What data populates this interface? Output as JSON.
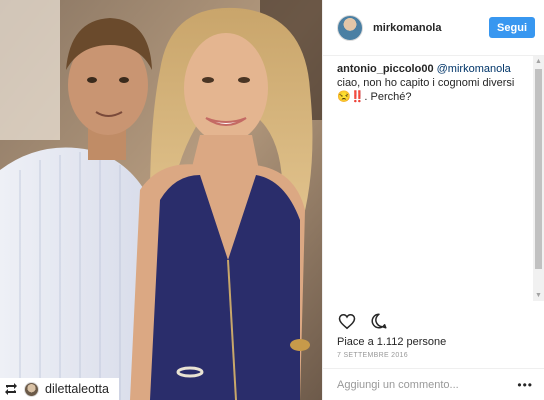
{
  "post": {
    "author": "mirkomanola",
    "follow_label": "Segui"
  },
  "comment": {
    "user": "antonio_piccolo00",
    "mention": "@mirkomanola",
    "text": " ciao, non ho capito i cognomi diversi😒‼️. Perché?"
  },
  "actions": {
    "like_icon": "heart-icon",
    "comment_icon": "speech-bubble-icon"
  },
  "likes_text": "Piace a 1.112 persone",
  "date_text": "7 SETTEMBRE 2016",
  "comment_box": {
    "placeholder": "Aggiungi un commento...",
    "more_label": "•••"
  },
  "repost": {
    "username": "dilettaleotta",
    "icon": "repost-icon"
  },
  "colors": {
    "follow_button": "#3897f0",
    "mention": "#003569",
    "dress": "#2a2d6b"
  }
}
